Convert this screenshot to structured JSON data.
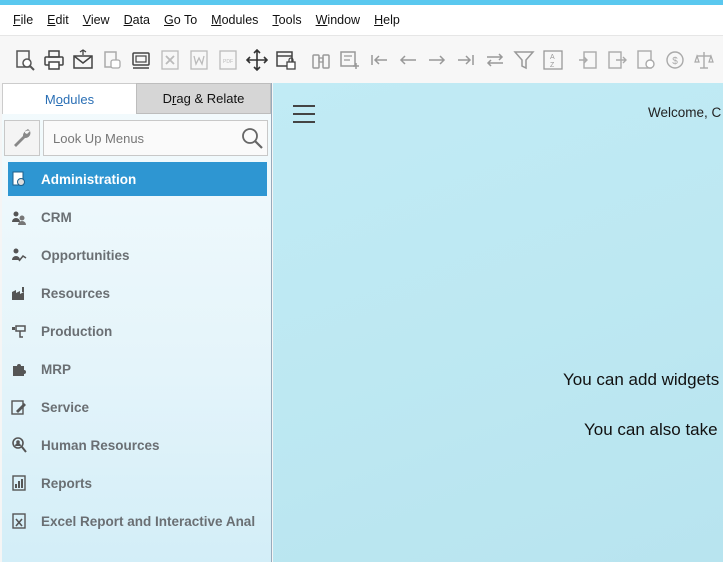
{
  "menu": {
    "items": [
      {
        "accel": "F",
        "rest": "ile"
      },
      {
        "accel": "E",
        "rest": "dit"
      },
      {
        "accel": "V",
        "rest": "iew"
      },
      {
        "accel": "D",
        "rest": "ata"
      },
      {
        "accel": "G",
        "rest": "o To"
      },
      {
        "accel": "M",
        "rest": "odules"
      },
      {
        "accel": "T",
        "rest": "ools"
      },
      {
        "accel": "W",
        "rest": "indow"
      },
      {
        "accel": "H",
        "rest": "elp"
      }
    ]
  },
  "toolbar": {
    "icons": [
      "print-preview-icon",
      "print-icon",
      "email-icon",
      "transfer-icon",
      "message-icon",
      "layout-icon",
      "excel-icon",
      "word-icon",
      "pdf-icon",
      "move-icon",
      "form-lock-icon",
      "binoculars-icon",
      "add-note-icon",
      "first-record-icon",
      "previous-record-icon",
      "next-record-icon",
      "last-record-icon",
      "refresh-icon",
      "filter-icon",
      "sort-icon",
      "base-document-icon",
      "target-document-icon",
      "document-settings-icon",
      "payment-icon",
      "balance-icon"
    ]
  },
  "sidebar": {
    "tabs": [
      {
        "pre": "M",
        "accel": "o",
        "post": "dules",
        "active": true
      },
      {
        "pre": "D",
        "accel": "r",
        "post": "ag & Relate",
        "active": false
      }
    ],
    "search_placeholder": "Look Up Menus",
    "modules": [
      {
        "label": "Administration",
        "icon": "administration-icon",
        "selected": true
      },
      {
        "label": "CRM",
        "icon": "crm-icon",
        "selected": false
      },
      {
        "label": "Opportunities",
        "icon": "opportunities-icon",
        "selected": false
      },
      {
        "label": "Resources",
        "icon": "resources-icon",
        "selected": false
      },
      {
        "label": "Production",
        "icon": "production-icon",
        "selected": false
      },
      {
        "label": "MRP",
        "icon": "mrp-icon",
        "selected": false
      },
      {
        "label": "Service",
        "icon": "service-icon",
        "selected": false
      },
      {
        "label": "Human Resources",
        "icon": "human-resources-icon",
        "selected": false
      },
      {
        "label": "Reports",
        "icon": "reports-icon",
        "selected": false
      },
      {
        "label": "Excel Report and Interactive Anal",
        "icon": "excel-report-icon",
        "selected": false
      }
    ]
  },
  "main": {
    "welcome": "Welcome, C",
    "line1": "You can add widgets",
    "line2": "You can also take"
  },
  "colors": {
    "accent_stripe": "#5ac8ef",
    "selected_module": "#2e96d2",
    "main_background": "#bde8f2"
  }
}
